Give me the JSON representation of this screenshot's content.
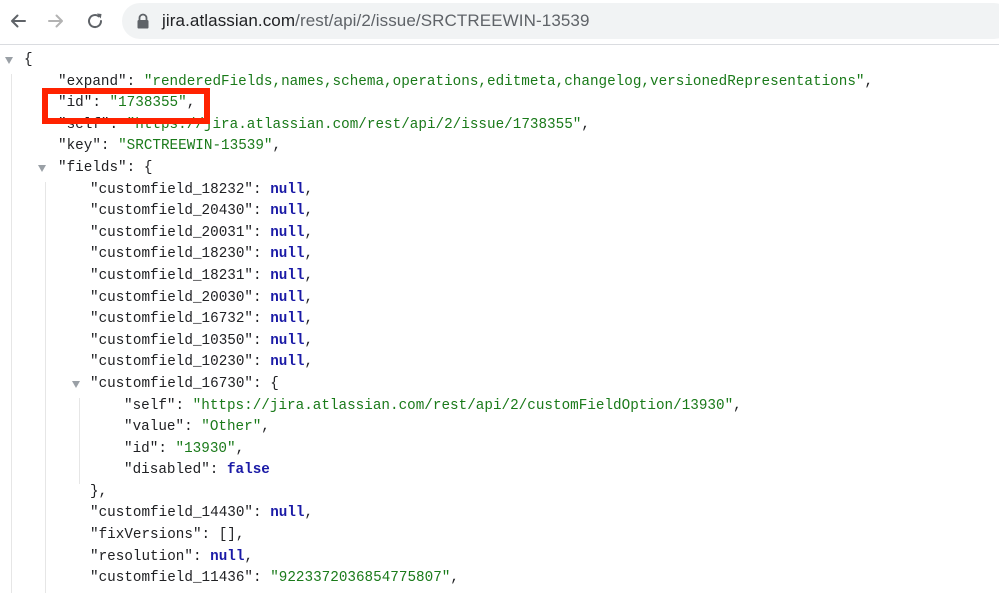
{
  "browser": {
    "url_host": "jira.atlassian.com",
    "url_path": "/rest/api/2/issue/SRCTREEWIN-13539"
  },
  "json_lines": [
    {
      "indent": 0,
      "toggle": true,
      "key": "",
      "punct": "{"
    },
    {
      "indent": 1,
      "toggle": false,
      "key": "\"expand\"",
      "sep": ": ",
      "value": "\"renderedFields,names,schema,operations,editmeta,changelog,versionedRepresentations\"",
      "vtype": "s",
      "punct": ","
    },
    {
      "indent": 1,
      "toggle": false,
      "key": "\"id\"",
      "sep": ": ",
      "value": "\"1738355\"",
      "vtype": "s",
      "punct": ","
    },
    {
      "indent": 1,
      "toggle": false,
      "key": "\"self\"",
      "sep": ": ",
      "value": "\"https://jira.atlassian.com/rest/api/2/issue/1738355\"",
      "vtype": "s",
      "punct": ","
    },
    {
      "indent": 1,
      "toggle": false,
      "key": "\"key\"",
      "sep": ": ",
      "value": "\"SRCTREEWIN-13539\"",
      "vtype": "s",
      "punct": ","
    },
    {
      "indent": 1,
      "toggle": true,
      "key": "\"fields\"",
      "sep": ": ",
      "value": "",
      "vtype": "k",
      "punct": "{"
    },
    {
      "indent": 2,
      "toggle": false,
      "key": "\"customfield_18232\"",
      "sep": ": ",
      "value": "null",
      "vtype": "n",
      "punct": ","
    },
    {
      "indent": 2,
      "toggle": false,
      "key": "\"customfield_20430\"",
      "sep": ": ",
      "value": "null",
      "vtype": "n",
      "punct": ","
    },
    {
      "indent": 2,
      "toggle": false,
      "key": "\"customfield_20031\"",
      "sep": ": ",
      "value": "null",
      "vtype": "n",
      "punct": ","
    },
    {
      "indent": 2,
      "toggle": false,
      "key": "\"customfield_18230\"",
      "sep": ": ",
      "value": "null",
      "vtype": "n",
      "punct": ","
    },
    {
      "indent": 2,
      "toggle": false,
      "key": "\"customfield_18231\"",
      "sep": ": ",
      "value": "null",
      "vtype": "n",
      "punct": ","
    },
    {
      "indent": 2,
      "toggle": false,
      "key": "\"customfield_20030\"",
      "sep": ": ",
      "value": "null",
      "vtype": "n",
      "punct": ","
    },
    {
      "indent": 2,
      "toggle": false,
      "key": "\"customfield_16732\"",
      "sep": ": ",
      "value": "null",
      "vtype": "n",
      "punct": ","
    },
    {
      "indent": 2,
      "toggle": false,
      "key": "\"customfield_10350\"",
      "sep": ": ",
      "value": "null",
      "vtype": "n",
      "punct": ","
    },
    {
      "indent": 2,
      "toggle": false,
      "key": "\"customfield_10230\"",
      "sep": ": ",
      "value": "null",
      "vtype": "n",
      "punct": ","
    },
    {
      "indent": 2,
      "toggle": true,
      "key": "\"customfield_16730\"",
      "sep": ": ",
      "value": "",
      "vtype": "k",
      "punct": "{"
    },
    {
      "indent": 3,
      "toggle": false,
      "key": "\"self\"",
      "sep": ": ",
      "value": "\"https://jira.atlassian.com/rest/api/2/customFieldOption/13930\"",
      "vtype": "s",
      "punct": ","
    },
    {
      "indent": 3,
      "toggle": false,
      "key": "\"value\"",
      "sep": ": ",
      "value": "\"Other\"",
      "vtype": "s",
      "punct": ","
    },
    {
      "indent": 3,
      "toggle": false,
      "key": "\"id\"",
      "sep": ": ",
      "value": "\"13930\"",
      "vtype": "s",
      "punct": ","
    },
    {
      "indent": 3,
      "toggle": false,
      "key": "\"disabled\"",
      "sep": ": ",
      "value": "false",
      "vtype": "n",
      "punct": ""
    },
    {
      "indent": 2,
      "toggle": false,
      "key": "",
      "sep": "",
      "value": "",
      "vtype": "k",
      "punct": "},"
    },
    {
      "indent": 2,
      "toggle": false,
      "key": "\"customfield_14430\"",
      "sep": ": ",
      "value": "null",
      "vtype": "n",
      "punct": ","
    },
    {
      "indent": 2,
      "toggle": false,
      "key": "\"fixVersions\"",
      "sep": ": ",
      "value": "[]",
      "vtype": "k",
      "punct": ","
    },
    {
      "indent": 2,
      "toggle": false,
      "key": "\"resolution\"",
      "sep": ": ",
      "value": "null",
      "vtype": "n",
      "punct": ","
    },
    {
      "indent": 2,
      "toggle": false,
      "key": "\"customfield_11436\"",
      "sep": ": ",
      "value": "\"9223372036854775807\"",
      "vtype": "s",
      "punct": ","
    }
  ],
  "highlight_color": "#ff2200",
  "colors": {
    "string": "#1a7a1a",
    "keyword": "#1a1aa6",
    "key": "#202124"
  },
  "icons": [
    "back-arrow-icon",
    "forward-arrow-icon",
    "reload-icon",
    "lock-icon",
    "collapse-triangle-icon"
  ]
}
